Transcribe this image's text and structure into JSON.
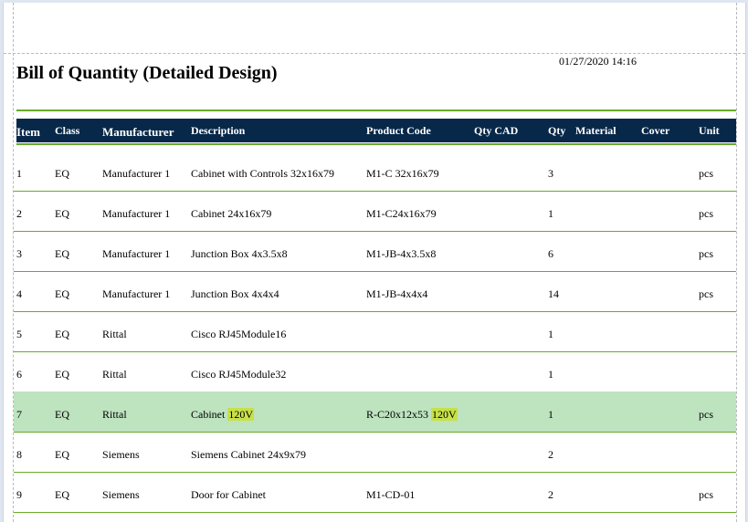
{
  "report": {
    "title": "Bill of Quantity (Detailed Design)",
    "datetime": "01/27/2020 14:16"
  },
  "columns": [
    "Item",
    "Class",
    "Manufacturer",
    "Description",
    "Product Code",
    "Qty CAD",
    "Qty",
    "Material",
    "Cover",
    "Unit"
  ],
  "highlight_term": "120V",
  "rows": [
    {
      "item": "1",
      "class": "EQ",
      "manufacturer": "Manufacturer 1",
      "description": "Cabinet with Controls 32x16x79",
      "product_code": "M1-C 32x16x79",
      "qty_cad": "",
      "qty": "3",
      "material": "",
      "cover": "",
      "unit": "pcs"
    },
    {
      "item": "2",
      "class": "EQ",
      "manufacturer": "Manufacturer 1",
      "description": "Cabinet 24x16x79",
      "product_code": "M1-C24x16x79",
      "qty_cad": "",
      "qty": "1",
      "material": "",
      "cover": "",
      "unit": "pcs"
    },
    {
      "item": "3",
      "class": "EQ",
      "manufacturer": "Manufacturer 1",
      "description": "Junction Box 4x3.5x8",
      "product_code": "M1-JB-4x3.5x8",
      "qty_cad": "",
      "qty": "6",
      "material": "",
      "cover": "",
      "unit": "pcs"
    },
    {
      "item": "4",
      "class": "EQ",
      "manufacturer": "Manufacturer 1",
      "description": "Junction Box 4x4x4",
      "product_code": "M1-JB-4x4x4",
      "qty_cad": "",
      "qty": "14",
      "material": "",
      "cover": "",
      "unit": "pcs"
    },
    {
      "item": "5",
      "class": "EQ",
      "manufacturer": "Rittal",
      "description": "Cisco RJ45Module16",
      "product_code": "",
      "qty_cad": "",
      "qty": "1",
      "material": "",
      "cover": "",
      "unit": ""
    },
    {
      "item": "6",
      "class": "EQ",
      "manufacturer": "Rittal",
      "description": "Cisco RJ45Module32",
      "product_code": "",
      "qty_cad": "",
      "qty": "1",
      "material": "",
      "cover": "",
      "unit": ""
    },
    {
      "item": "7",
      "class": "EQ",
      "manufacturer": "Rittal",
      "description": "Cabinet 120V",
      "product_code": "R-C20x12x53 120V",
      "qty_cad": "",
      "qty": "1",
      "material": "",
      "cover": "",
      "unit": "pcs",
      "selected": true
    },
    {
      "item": "8",
      "class": "EQ",
      "manufacturer": "Siemens",
      "description": "Siemens Cabinet 24x9x79",
      "product_code": "",
      "qty_cad": "",
      "qty": "2",
      "material": "",
      "cover": "",
      "unit": ""
    },
    {
      "item": "9",
      "class": "EQ",
      "manufacturer": "Siemens",
      "description": "Door for Cabinet",
      "product_code": "M1-CD-01",
      "qty_cad": "",
      "qty": "2",
      "material": "",
      "cover": "",
      "unit": "pcs"
    }
  ]
}
